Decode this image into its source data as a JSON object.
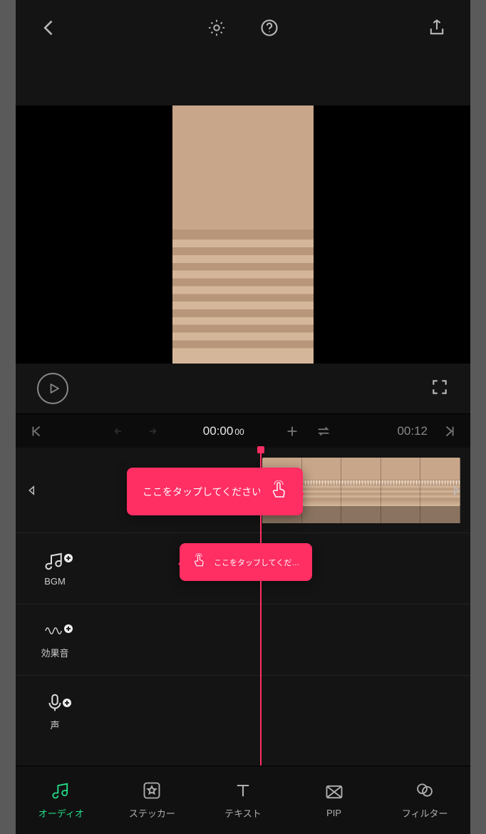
{
  "colors": {
    "accent": "#ff2e63",
    "active": "#22dd88"
  },
  "timeline": {
    "current_time": "00:00",
    "current_ms": "00",
    "total_time": "00:12"
  },
  "hints": {
    "video_bubble": "ここをタップしてください",
    "bgm_bubble": "ここをタップしてくだ…"
  },
  "tracks": {
    "bgm_label": "BGM",
    "sfx_label": "効果音",
    "voice_label": "声"
  },
  "bottom_nav": [
    {
      "key": "audio",
      "label": "オーディオ",
      "active": true
    },
    {
      "key": "sticker",
      "label": "ステッカー",
      "active": false
    },
    {
      "key": "text",
      "label": "テキスト",
      "active": false
    },
    {
      "key": "pip",
      "label": "PIP",
      "active": false
    },
    {
      "key": "filter",
      "label": "フィルター",
      "active": false
    }
  ],
  "icons": {
    "back": "back-icon",
    "settings": "gear-icon",
    "help": "help-icon",
    "export": "export-icon",
    "play": "play-icon",
    "expand": "expand-icon",
    "skip_start": "skip-start-icon",
    "skip_end": "skip-end-icon",
    "undo": "undo-icon",
    "redo": "redo-icon",
    "plus": "plus-icon",
    "swap": "swap-icon",
    "tap": "tap-icon",
    "arrow_left": "tri-left-icon",
    "arrow_right": "tri-right-icon",
    "music": "music-icon",
    "wave": "wave-icon",
    "mic": "mic-icon",
    "sticker": "star-box-icon",
    "text": "text-icon",
    "pip": "pip-icon",
    "filter": "filter-icon"
  }
}
